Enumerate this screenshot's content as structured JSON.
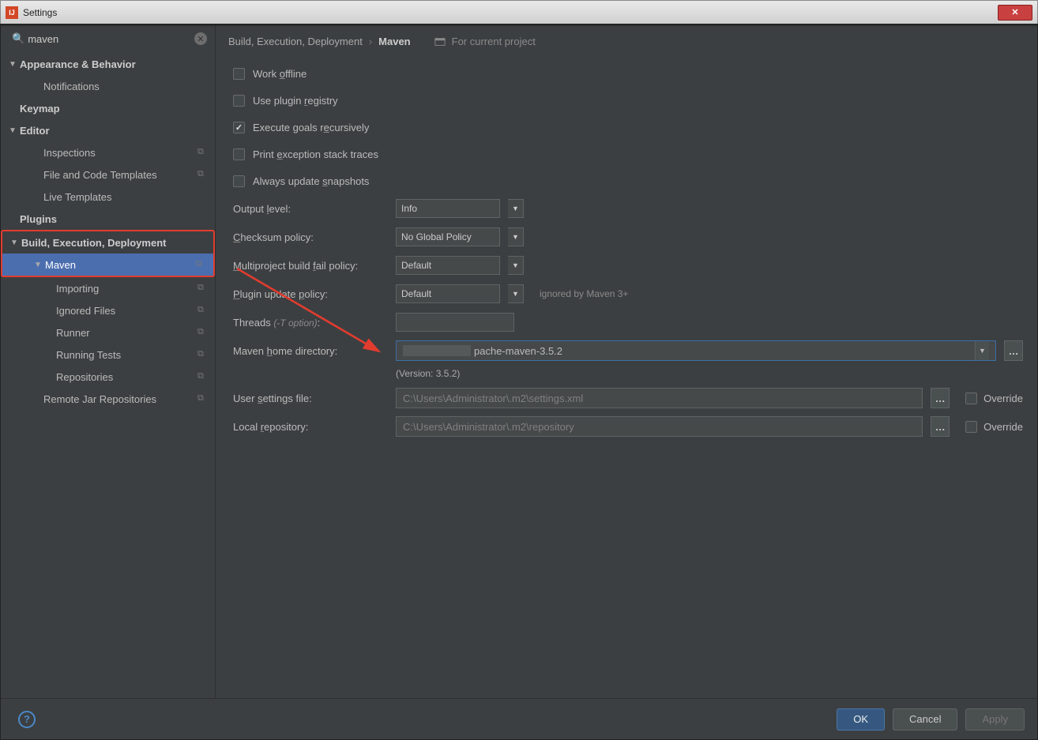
{
  "titlebar": {
    "title": "Settings"
  },
  "search": {
    "value": "maven"
  },
  "sidebar": {
    "items": [
      {
        "label": "Appearance & Behavior",
        "bold": true,
        "exp": true
      },
      {
        "label": "Notifications",
        "ind": 1
      },
      {
        "label": "Keymap",
        "bold": true
      },
      {
        "label": "Editor",
        "bold": true,
        "exp": true
      },
      {
        "label": "Inspections",
        "ind": 1,
        "copy": true
      },
      {
        "label": "File and Code Templates",
        "ind": 1,
        "copy": true
      },
      {
        "label": "Live Templates",
        "ind": 1
      },
      {
        "label": "Plugins",
        "bold": true
      },
      {
        "label": "Build, Execution, Deployment",
        "bold": true,
        "exp": true,
        "hl": "start"
      },
      {
        "label": "Maven",
        "ind": 1,
        "exp": true,
        "selected": true,
        "copy": true,
        "hl": "end"
      },
      {
        "label": "Importing",
        "ind": 2,
        "copy": true
      },
      {
        "label": "Ignored Files",
        "ind": 2,
        "copy": true
      },
      {
        "label": "Runner",
        "ind": 2,
        "copy": true
      },
      {
        "label": "Running Tests",
        "ind": 2,
        "copy": true
      },
      {
        "label": "Repositories",
        "ind": 2,
        "copy": true
      },
      {
        "label": "Remote Jar Repositories",
        "ind": 1,
        "copy": true
      }
    ]
  },
  "breadcrumb": {
    "root": "Build, Execution, Deployment",
    "leaf": "Maven",
    "project_hint": "For current project"
  },
  "checks": {
    "work_offline": "Work offline",
    "use_plugin_registry": "Use plugin registry",
    "exec_goals": "Execute goals recursively",
    "print_exc": "Print exception stack traces",
    "always_update": "Always update snapshots"
  },
  "fields": {
    "output_level": {
      "label": "Output level:",
      "value": "Info"
    },
    "checksum": {
      "label": "Checksum policy:",
      "value": "No Global Policy"
    },
    "multiproject": {
      "label": "Multiproject build fail policy:",
      "value": "Default"
    },
    "plugin_update": {
      "label": "Plugin update policy:",
      "value": "Default",
      "hint": "ignored by Maven 3+"
    },
    "threads": {
      "label": "Threads",
      "opt": "(-T option)",
      "value": ""
    },
    "maven_home": {
      "label": "Maven home directory:",
      "value": "pache-maven-3.5.2"
    },
    "version": "(Version: 3.5.2)",
    "user_settings": {
      "label": "User settings file:",
      "value": "C:\\Users\\Administrator\\.m2\\settings.xml",
      "override": "Override"
    },
    "local_repo": {
      "label": "Local repository:",
      "value": "C:\\Users\\Administrator\\.m2\\repository",
      "override": "Override"
    }
  },
  "footer": {
    "ok": "OK",
    "cancel": "Cancel",
    "apply": "Apply"
  }
}
